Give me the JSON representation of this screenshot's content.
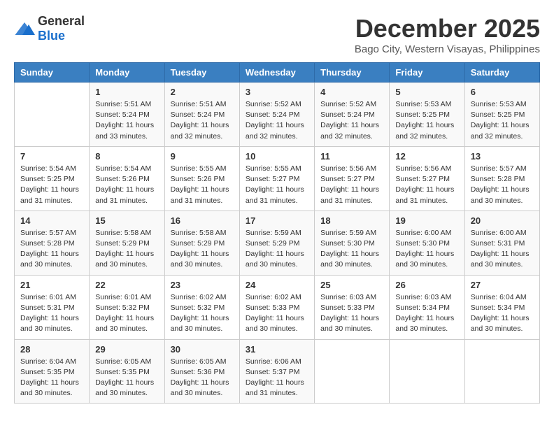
{
  "logo": {
    "general": "General",
    "blue": "Blue"
  },
  "title": "December 2025",
  "location": "Bago City, Western Visayas, Philippines",
  "days_header": [
    "Sunday",
    "Monday",
    "Tuesday",
    "Wednesday",
    "Thursday",
    "Friday",
    "Saturday"
  ],
  "weeks": [
    [
      {
        "num": "",
        "info": ""
      },
      {
        "num": "1",
        "info": "Sunrise: 5:51 AM\nSunset: 5:24 PM\nDaylight: 11 hours\nand 33 minutes."
      },
      {
        "num": "2",
        "info": "Sunrise: 5:51 AM\nSunset: 5:24 PM\nDaylight: 11 hours\nand 32 minutes."
      },
      {
        "num": "3",
        "info": "Sunrise: 5:52 AM\nSunset: 5:24 PM\nDaylight: 11 hours\nand 32 minutes."
      },
      {
        "num": "4",
        "info": "Sunrise: 5:52 AM\nSunset: 5:24 PM\nDaylight: 11 hours\nand 32 minutes."
      },
      {
        "num": "5",
        "info": "Sunrise: 5:53 AM\nSunset: 5:25 PM\nDaylight: 11 hours\nand 32 minutes."
      },
      {
        "num": "6",
        "info": "Sunrise: 5:53 AM\nSunset: 5:25 PM\nDaylight: 11 hours\nand 32 minutes."
      }
    ],
    [
      {
        "num": "7",
        "info": "Sunrise: 5:54 AM\nSunset: 5:25 PM\nDaylight: 11 hours\nand 31 minutes."
      },
      {
        "num": "8",
        "info": "Sunrise: 5:54 AM\nSunset: 5:26 PM\nDaylight: 11 hours\nand 31 minutes."
      },
      {
        "num": "9",
        "info": "Sunrise: 5:55 AM\nSunset: 5:26 PM\nDaylight: 11 hours\nand 31 minutes."
      },
      {
        "num": "10",
        "info": "Sunrise: 5:55 AM\nSunset: 5:27 PM\nDaylight: 11 hours\nand 31 minutes."
      },
      {
        "num": "11",
        "info": "Sunrise: 5:56 AM\nSunset: 5:27 PM\nDaylight: 11 hours\nand 31 minutes."
      },
      {
        "num": "12",
        "info": "Sunrise: 5:56 AM\nSunset: 5:27 PM\nDaylight: 11 hours\nand 31 minutes."
      },
      {
        "num": "13",
        "info": "Sunrise: 5:57 AM\nSunset: 5:28 PM\nDaylight: 11 hours\nand 30 minutes."
      }
    ],
    [
      {
        "num": "14",
        "info": "Sunrise: 5:57 AM\nSunset: 5:28 PM\nDaylight: 11 hours\nand 30 minutes."
      },
      {
        "num": "15",
        "info": "Sunrise: 5:58 AM\nSunset: 5:29 PM\nDaylight: 11 hours\nand 30 minutes."
      },
      {
        "num": "16",
        "info": "Sunrise: 5:58 AM\nSunset: 5:29 PM\nDaylight: 11 hours\nand 30 minutes."
      },
      {
        "num": "17",
        "info": "Sunrise: 5:59 AM\nSunset: 5:29 PM\nDaylight: 11 hours\nand 30 minutes."
      },
      {
        "num": "18",
        "info": "Sunrise: 5:59 AM\nSunset: 5:30 PM\nDaylight: 11 hours\nand 30 minutes."
      },
      {
        "num": "19",
        "info": "Sunrise: 6:00 AM\nSunset: 5:30 PM\nDaylight: 11 hours\nand 30 minutes."
      },
      {
        "num": "20",
        "info": "Sunrise: 6:00 AM\nSunset: 5:31 PM\nDaylight: 11 hours\nand 30 minutes."
      }
    ],
    [
      {
        "num": "21",
        "info": "Sunrise: 6:01 AM\nSunset: 5:31 PM\nDaylight: 11 hours\nand 30 minutes."
      },
      {
        "num": "22",
        "info": "Sunrise: 6:01 AM\nSunset: 5:32 PM\nDaylight: 11 hours\nand 30 minutes."
      },
      {
        "num": "23",
        "info": "Sunrise: 6:02 AM\nSunset: 5:32 PM\nDaylight: 11 hours\nand 30 minutes."
      },
      {
        "num": "24",
        "info": "Sunrise: 6:02 AM\nSunset: 5:33 PM\nDaylight: 11 hours\nand 30 minutes."
      },
      {
        "num": "25",
        "info": "Sunrise: 6:03 AM\nSunset: 5:33 PM\nDaylight: 11 hours\nand 30 minutes."
      },
      {
        "num": "26",
        "info": "Sunrise: 6:03 AM\nSunset: 5:34 PM\nDaylight: 11 hours\nand 30 minutes."
      },
      {
        "num": "27",
        "info": "Sunrise: 6:04 AM\nSunset: 5:34 PM\nDaylight: 11 hours\nand 30 minutes."
      }
    ],
    [
      {
        "num": "28",
        "info": "Sunrise: 6:04 AM\nSunset: 5:35 PM\nDaylight: 11 hours\nand 30 minutes."
      },
      {
        "num": "29",
        "info": "Sunrise: 6:05 AM\nSunset: 5:35 PM\nDaylight: 11 hours\nand 30 minutes."
      },
      {
        "num": "30",
        "info": "Sunrise: 6:05 AM\nSunset: 5:36 PM\nDaylight: 11 hours\nand 30 minutes."
      },
      {
        "num": "31",
        "info": "Sunrise: 6:06 AM\nSunset: 5:37 PM\nDaylight: 11 hours\nand 31 minutes."
      },
      {
        "num": "",
        "info": ""
      },
      {
        "num": "",
        "info": ""
      },
      {
        "num": "",
        "info": ""
      }
    ]
  ]
}
